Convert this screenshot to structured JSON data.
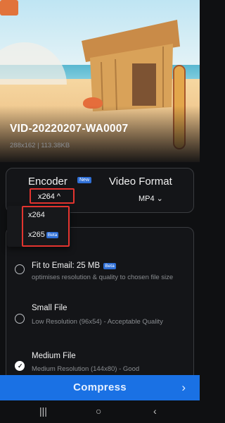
{
  "video": {
    "title": "VID-20220207-WA0007",
    "meta": "288x162  |  113.38KB"
  },
  "encoder": {
    "label": "Encoder",
    "badge": "New",
    "selected": "x264 ^",
    "options": [
      {
        "label": "x264",
        "badge": ""
      },
      {
        "label": "x265",
        "badge": "Beta"
      }
    ]
  },
  "video_format": {
    "label": "Video Format",
    "selected": "MP4 ⌄"
  },
  "compression_options": [
    {
      "title": "Fit to Email: 25 MB",
      "badge": "Beta",
      "desc": "optimises resolution & quality to chosen file size",
      "selected": false
    },
    {
      "title": "Small File",
      "badge": "",
      "desc": "Low Resolution (96x54) - Acceptable Quality",
      "selected": false
    },
    {
      "title": "Medium File",
      "badge": "",
      "desc": "Medium Resolution (144x80) - Good",
      "selected": true
    }
  ],
  "compress_button": {
    "label": "Compress",
    "arrow": "›"
  },
  "system_nav": {
    "recents": "|||",
    "home": "○",
    "back": "‹"
  },
  "icons": {
    "check": "✓"
  }
}
